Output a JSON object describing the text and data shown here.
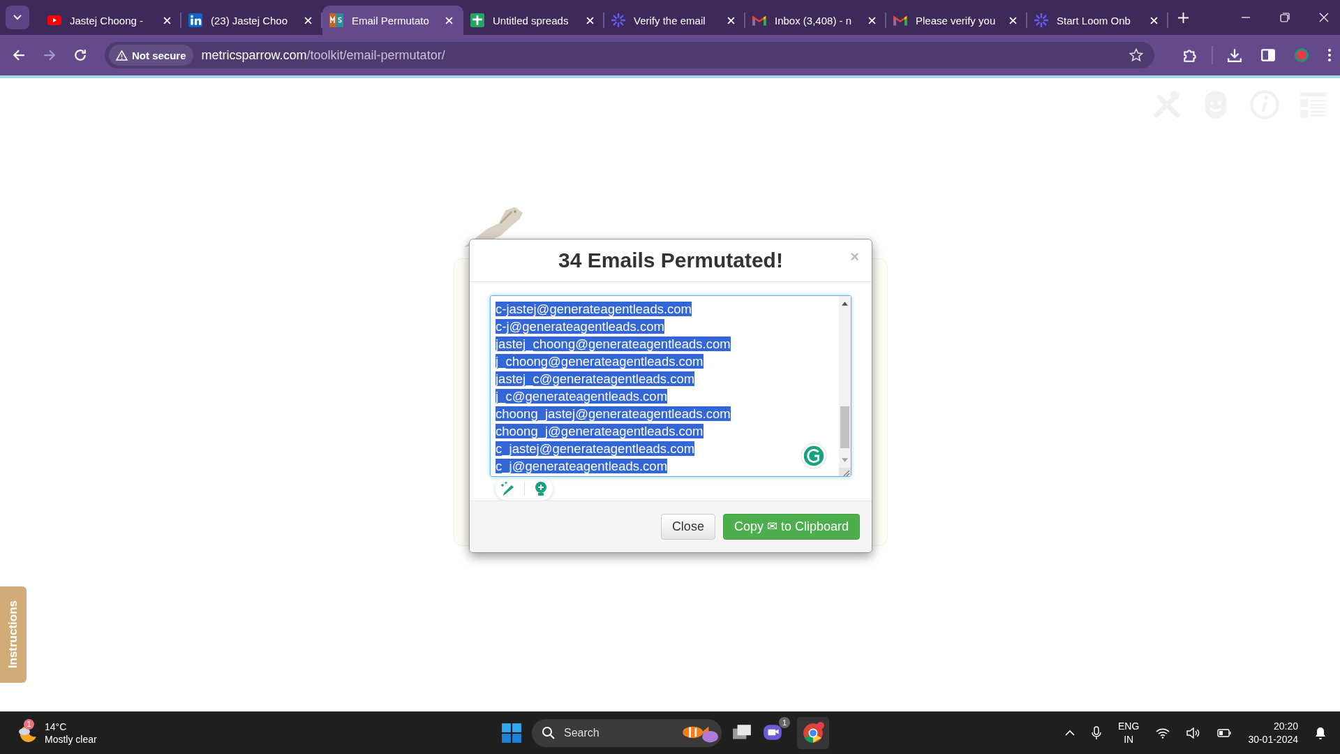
{
  "browser": {
    "tabs": [
      {
        "title": "Jastej Choong -",
        "kind": "video",
        "selected": false
      },
      {
        "title": "(23) Jastej Choo",
        "kind": "social",
        "selected": false
      },
      {
        "title": "Email Permutato",
        "kind": "tool",
        "selected": true
      },
      {
        "title": "Untitled spreads",
        "kind": "sheet",
        "selected": false
      },
      {
        "title": "Verify the email",
        "kind": "recorder",
        "selected": false
      },
      {
        "title": "Inbox (3,408) - n",
        "kind": "mail",
        "selected": false
      },
      {
        "title": "Please verify you",
        "kind": "mail",
        "selected": false
      },
      {
        "title": "Start Loom Onb",
        "kind": "recorder",
        "selected": false
      }
    ],
    "address": {
      "security": "Not secure",
      "host": "metricsparrow.com",
      "path": "/toolkit/email-permutator/"
    }
  },
  "page": {
    "side_tab": "Instructions"
  },
  "dialog": {
    "title": "34 Emails Permutated!",
    "close": "×",
    "emails": [
      {
        "text": "c-jastej@generateagentleads.com",
        "selected": true
      },
      {
        "text": "c-j@generateagentleads.com",
        "selected": true
      },
      {
        "text": "jastej_choong@generateagentleads.com",
        "selected": true
      },
      {
        "text": "j_choong@generateagentleads.com",
        "selected": true
      },
      {
        "text": "jastej_c@generateagentleads.com",
        "selected": true
      },
      {
        "text": "j_c@generateagentleads.com",
        "selected": true
      },
      {
        "text": "choong_jastej@generateagentleads.com",
        "selected": true
      },
      {
        "text": "choong_j@generateagentleads.com",
        "selected": true
      },
      {
        "text": "c_jastej@generateagentleads.com",
        "selected": true
      },
      {
        "text": "c_j@generateagentleads.com",
        "selected": true
      }
    ],
    "buttons": {
      "close": "Close",
      "copy": "Copy",
      "copy_icon": "✉",
      "copy_rest": "to Clipboard"
    }
  },
  "taskbar": {
    "weather": {
      "badge": "1",
      "temp": "14°C",
      "condition": "Mostly clear"
    },
    "search": "Search",
    "chat_badge": "1",
    "lang": "ENG",
    "region": "IN",
    "time": "20:20",
    "date": "30-01-2024"
  }
}
